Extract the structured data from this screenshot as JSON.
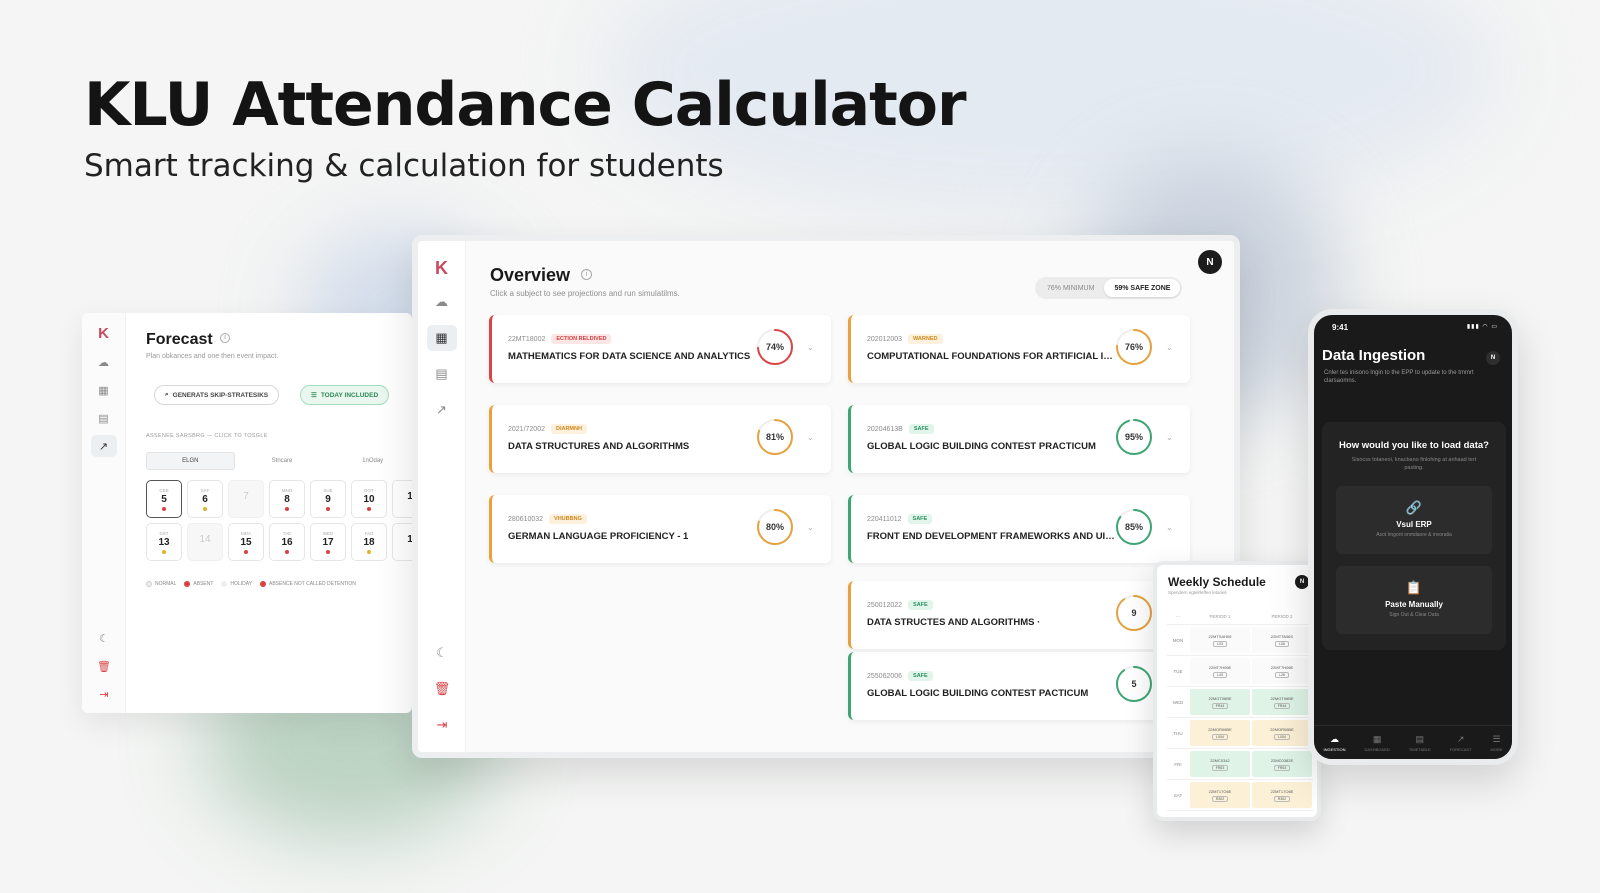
{
  "hero": {
    "title": "KLU Attendance Calculator",
    "subtitle": "Smart tracking & calculation for students"
  },
  "forecast": {
    "title": "Forecast",
    "description": "Plan obkances and one then event impact.",
    "generate_button": "GENERATS SKIP-STRATESIKS",
    "today_button": "TODAY INCLUDED",
    "section_label": "ASSENEE SARSBRG — CLICK TO TOSGLE",
    "tabs": [
      "ELGN",
      "Stncare",
      "1nOday"
    ],
    "days_row1": [
      {
        "dow": "CEE",
        "num": "5",
        "dot": "red",
        "sel": true
      },
      {
        "dow": "SAT",
        "num": "6",
        "dot": "yellow"
      },
      {
        "dow": "",
        "num": "7",
        "dot": "none",
        "dim": true
      },
      {
        "dow": "MNO",
        "num": "8",
        "dot": "red"
      },
      {
        "dow": "SUE",
        "num": "9",
        "dot": "red"
      },
      {
        "dow": "DOT",
        "num": "10",
        "dot": "red"
      },
      {
        "dow": "",
        "num": "1",
        "dot": "none"
      }
    ],
    "days_row2": [
      {
        "dow": "DST",
        "num": "13",
        "dot": "yellow"
      },
      {
        "dow": "",
        "num": "14",
        "dot": "none",
        "dim": true
      },
      {
        "dow": "MDA",
        "num": "15",
        "dot": "red"
      },
      {
        "dow": "TAE",
        "num": "16",
        "dot": "red"
      },
      {
        "dow": "WED",
        "num": "17",
        "dot": "red"
      },
      {
        "dow": "FAD",
        "num": "18",
        "dot": "yellow"
      },
      {
        "dow": "",
        "num": "1",
        "dot": "none"
      }
    ],
    "legend": [
      "NORMAL",
      "ABSENT",
      "HOLIDAY",
      "ABSENCE NOT CALLED DETENTION"
    ]
  },
  "overview": {
    "title": "Overview",
    "description": "Click a subject to see projections and run simulatilms.",
    "toggle": [
      "76% MINIMUM",
      "59% SAFE ZONE"
    ],
    "avatar": "N",
    "subjects": [
      {
        "code": "22MT18002",
        "badge": "ECTION RELDIVED",
        "badge_color": "red",
        "name": "MATHEMATICS FOR DATA SCIENCE AND ANALYTICS",
        "pct": 74,
        "pct_label": "74%",
        "color": "#d94545",
        "accent": "red"
      },
      {
        "code": "202012003",
        "badge": "WARNED",
        "badge_color": "orange",
        "name": "COMPUTATIONAL FOUNDATIONS FOR ARTIFICIAL IN...",
        "pct": 76,
        "pct_label": "76%",
        "color": "#e5a23e",
        "accent": "orange"
      },
      {
        "code": "2021/72002",
        "badge": "DIARMNH",
        "badge_color": "orange",
        "name": "DATA STRUCTURES AND ALGORITHMS",
        "pct": 81,
        "pct_label": "81%",
        "color": "#e5a23e",
        "accent": "orange"
      },
      {
        "code": "20204613B",
        "badge": "SAFE",
        "badge_color": "green",
        "name": "GLOBAL LOGIC BUILDING CONTEST PRACTICUM",
        "pct": 95,
        "pct_label": "95%",
        "color": "#3da673",
        "accent": "green"
      },
      {
        "code": "280610032",
        "badge": "VHUBBNG",
        "badge_color": "orange",
        "name": "GERMAN LANGUAGE PROFICIENCY - 1",
        "pct": 80,
        "pct_label": "80%",
        "color": "#e5a23e",
        "accent": "orange"
      },
      {
        "code": "220411012",
        "badge": "SAFE",
        "badge_color": "green",
        "name": "FRONT END DEVELOPMENT FRAMEWORKS AND UI E...",
        "pct": 85,
        "pct_label": "85%",
        "color": "#3da673",
        "accent": "green"
      },
      {
        "code": "250012022",
        "badge": "SAFE",
        "badge_color": "green",
        "name": "DATA STRUCTES AND ALGORITHMS ·",
        "pct": 90,
        "pct_label": "9",
        "color": "#e5a23e",
        "accent": "orange"
      },
      {
        "code": "255062006",
        "badge": "SAFE",
        "badge_color": "green",
        "name": "GLOBAL LOGIC BUILDING CONTEST PACTICUM",
        "pct": 90,
        "pct_label": "5",
        "color": "#3da673",
        "accent": "green"
      }
    ]
  },
  "weekly": {
    "title": "Weekly Schedule",
    "subtitle": "Spendern egtelrlefferi letarieli",
    "avatar": "N",
    "headers": [
      "PERIOD 1",
      "PERIOD 2"
    ],
    "rows": [
      {
        "day": "MON",
        "cells": [
          {
            "code": "22MTSAH06",
            "tag": "L03",
            "tone": "plain"
          },
          {
            "code": "22MTTA06S",
            "tag": "L06",
            "tone": "plain"
          }
        ]
      },
      {
        "day": "TUE",
        "cells": [
          {
            "code": "22MT7H06E",
            "tag": "L43",
            "tone": "plain"
          },
          {
            "code": "22MT7H06E",
            "tag": "L26",
            "tone": "plain"
          }
        ]
      },
      {
        "day": "WED",
        "cells": [
          {
            "code": "22MGT06BE",
            "tag": "FR44",
            "tone": "green"
          },
          {
            "code": "22MGT06BE",
            "tag": "FR44",
            "tone": "green"
          }
        ]
      },
      {
        "day": "THU",
        "cells": [
          {
            "code": "22MOR06BE",
            "tag": "L004",
            "tone": "yellow"
          },
          {
            "code": "22MOR06BE",
            "tag": "L004",
            "tone": "yellow"
          }
        ]
      },
      {
        "day": "FRI",
        "cells": [
          {
            "code": "22MC0342",
            "tag": "FR63",
            "tone": "green"
          },
          {
            "code": "22MC0382E",
            "tag": "FR63",
            "tone": "green"
          }
        ]
      },
      {
        "day": "SAT",
        "cells": [
          {
            "code": "22MT17O6E",
            "tag": "R302",
            "tone": "yellow"
          },
          {
            "code": "22MT17O6E",
            "tag": "R302",
            "tone": "yellow"
          }
        ]
      }
    ]
  },
  "phone": {
    "time": "9:41",
    "title": "Data Ingestion",
    "avatar": "N",
    "description": "Cnler tes inisono lngin to the EPP to update to the tmmrt clarsaomns.",
    "question": "How would you like to load data?",
    "question_sub": "Sisocss totaneoi, knacbano finlohing at anhaad tert pasting.",
    "option1": {
      "label": "Vsul ERP",
      "sub": "Asot lrngont onmdaore & invoratia"
    },
    "option2": {
      "label": "Paste Manually",
      "sub": "Sign Out & Clear Data"
    },
    "nav": [
      "INGESTION",
      "DASHBOARD",
      "TIMETABLE",
      "FORECAST",
      "MORE"
    ]
  }
}
